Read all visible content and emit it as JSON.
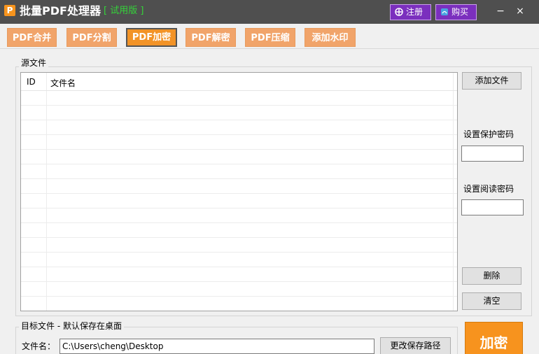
{
  "titlebar": {
    "logo_letter": "P",
    "title": "批量PDF处理器",
    "badge": "[ 试用版 ]",
    "register_label": "注册",
    "buy_label": "购买",
    "minimize": "−",
    "close": "×"
  },
  "tabs": [
    {
      "label": "PDF合并"
    },
    {
      "label": "PDF分割"
    },
    {
      "label": "PDF加密"
    },
    {
      "label": "PDF解密"
    },
    {
      "label": "PDF压缩"
    },
    {
      "label": "添加水印"
    }
  ],
  "source": {
    "group_title": "源文件",
    "columns": [
      "ID",
      "文件名"
    ],
    "add_button": "添加文件",
    "protect_password_label": "设置保护密码",
    "protect_password_value": "",
    "read_password_label": "设置阅读密码",
    "read_password_value": "",
    "delete_button": "删除",
    "clear_button": "清空"
  },
  "target": {
    "group_title": "目标文件 - 默认保存在桌面",
    "filename_label": "文件名：",
    "filename_value": "C:\\Users\\cheng\\Desktop",
    "change_path_button": "更改保存路径"
  },
  "action": {
    "encrypt_button": "加密"
  },
  "colors": {
    "titlebar": "#4f4f4f",
    "tab": "#f1a46a",
    "tab_active": "#f29327",
    "badge": "#35d43a",
    "purple_button": "#7b2fbe",
    "encrypt": "#f7931e"
  }
}
